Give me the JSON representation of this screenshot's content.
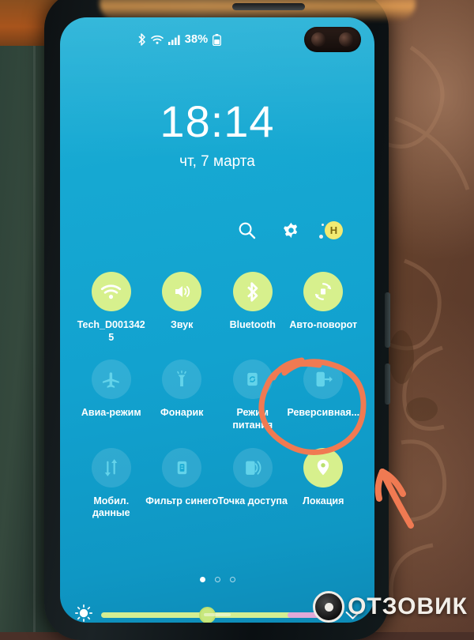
{
  "statusbar": {
    "bluetooth_icon": "bluetooth-icon",
    "wifi_icon": "wifi-icon",
    "signal_icon": "cellular-signal-icon",
    "battery_percent": "38%",
    "battery_icon": "battery-icon"
  },
  "clock": {
    "time": "18:14",
    "date": "чт, 7 марта"
  },
  "actions": {
    "search_icon": "search-icon",
    "settings_icon": "gear-icon",
    "profile_initial": "H"
  },
  "quick_settings": {
    "rows": [
      [
        {
          "label": "Tech_D0013425",
          "icon": "wifi-icon",
          "state": "on"
        },
        {
          "label": "Звук",
          "icon": "sound-icon",
          "state": "on"
        },
        {
          "label": "Bluetooth",
          "icon": "bluetooth-icon",
          "state": "on"
        },
        {
          "label": "Авто-поворот",
          "icon": "auto-rotate-icon",
          "state": "on"
        }
      ],
      [
        {
          "label": "Авиа-режим",
          "icon": "airplane-icon",
          "state": "off"
        },
        {
          "label": "Фонарик",
          "icon": "flashlight-icon",
          "state": "off"
        },
        {
          "label": "Режим питания",
          "icon": "power-mode-icon",
          "state": "off"
        },
        {
          "label": "Реверсивная...",
          "icon": "reverse-charging-icon",
          "state": "off"
        }
      ],
      [
        {
          "label": "Мобил. данные",
          "icon": "mobile-data-icon",
          "state": "off"
        },
        {
          "label": "Фильтр синего",
          "icon": "blue-light-filter-icon",
          "state": "off"
        },
        {
          "label": "Точка доступа",
          "icon": "hotspot-icon",
          "state": "off"
        },
        {
          "label": "Локация",
          "icon": "location-pin-icon",
          "state": "on"
        }
      ]
    ]
  },
  "pager": {
    "total": 3,
    "active_index": 0
  },
  "brightness": {
    "sun_icon": "brightness-sun-icon",
    "value_percent": 45,
    "expand_icon": "chevron-down-icon"
  },
  "annotation": {
    "circle_target": "Реверсивная...",
    "arrow": "arrow-pointing-up-left",
    "color": "#f07a52"
  },
  "watermark": {
    "text": "ОТЗОВИК"
  },
  "colors": {
    "screen_cyan": "#16a8d2",
    "tile_active": "#d7f08d",
    "annotation_orange": "#f07a52",
    "profile_badge": "#f2ea72"
  }
}
